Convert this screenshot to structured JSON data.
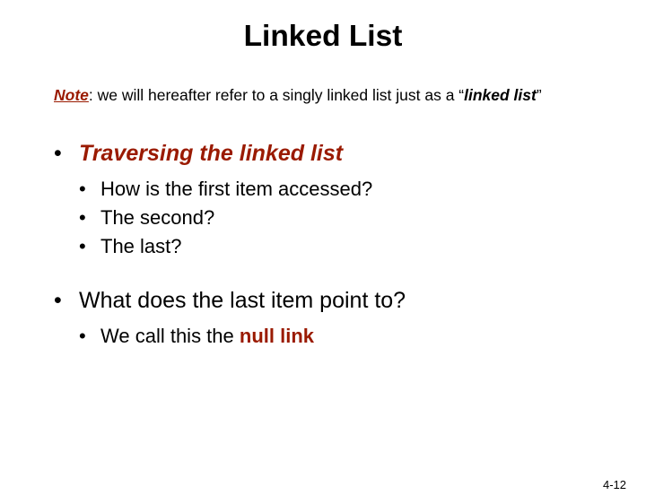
{
  "title": "Linked List",
  "note": {
    "label": "Note",
    "prefix": ": we will hereafter refer to a singly linked list just as a “",
    "emph": "linked list",
    "suffix": "”"
  },
  "bullets": {
    "b1": {
      "text": "Traversing the linked list"
    },
    "b1_subs": [
      "How is the first item accessed?",
      "The second?",
      "The last?"
    ],
    "b2": {
      "text": "What does the last item point to?"
    },
    "b2_sub_prefix": "We call this the ",
    "b2_sub_emph": "null link"
  },
  "slide_number": "4-12",
  "bullet_char": "•"
}
